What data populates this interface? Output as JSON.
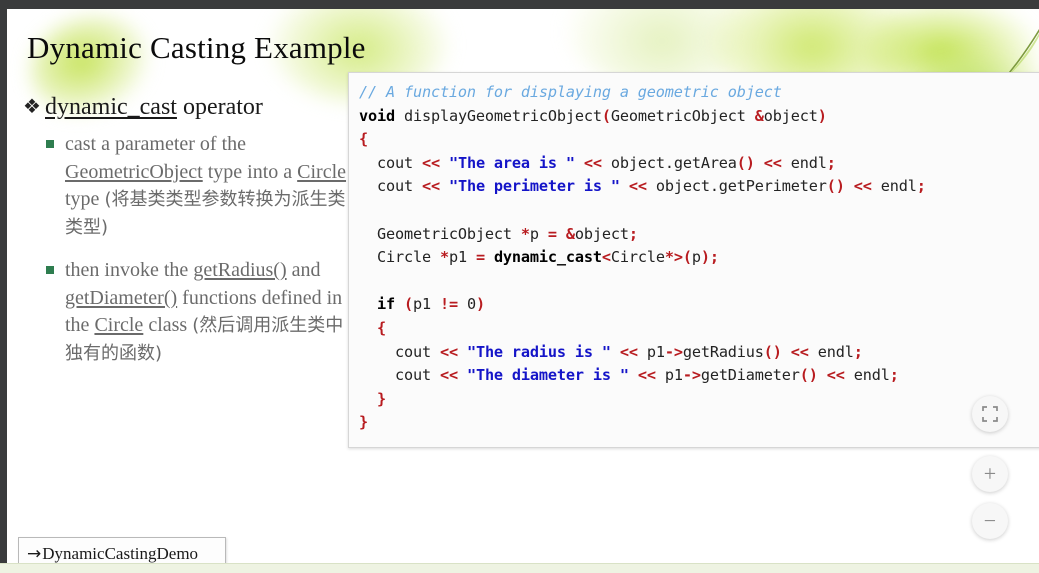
{
  "slide": {
    "title": "Dynamic Casting Example",
    "bullets": {
      "level1_marker": "❖",
      "level1": {
        "underlined": "dynamic_cast",
        "rest": " operator"
      },
      "level2": [
        {
          "marker": "square-bullet",
          "parts": [
            {
              "text": "cast a parameter of the ",
              "underline": false
            },
            {
              "text": "GeometricObject",
              "underline": true
            },
            {
              "text": " type into a ",
              "underline": false
            },
            {
              "text": "Circle",
              "underline": true
            },
            {
              "text": " type ",
              "underline": false
            },
            {
              "text": "(将基类类型参数转换为派生类类型)",
              "underline": false,
              "cjk": true
            }
          ]
        },
        {
          "marker": "square-bullet",
          "parts": [
            {
              "text": "then invoke the ",
              "underline": false
            },
            {
              "text": "getRadius()",
              "underline": true
            },
            {
              "text": " and ",
              "underline": false
            },
            {
              "text": "getDiameter()",
              "underline": true
            },
            {
              "text": " functions defined in the ",
              "underline": false
            },
            {
              "text": "Circle",
              "underline": true
            },
            {
              "text": " class ",
              "underline": false
            },
            {
              "text": "(然后调用派生类中独有的函数)",
              "underline": false,
              "cjk": true
            }
          ]
        }
      ]
    },
    "demo_button": {
      "arrow": "→",
      "label": "DynamicCastingDemo"
    }
  },
  "code": {
    "language": "cpp",
    "lines": [
      [
        {
          "t": "// A function for displaying a geometric object",
          "c": "com"
        }
      ],
      [
        {
          "t": "void",
          "c": "kw"
        },
        {
          "t": " displayGeometricObject",
          "c": "pl"
        },
        {
          "t": "(",
          "c": "pun"
        },
        {
          "t": "GeometricObject ",
          "c": "pl"
        },
        {
          "t": "&",
          "c": "pun"
        },
        {
          "t": "object",
          "c": "pl"
        },
        {
          "t": ")",
          "c": "pun"
        }
      ],
      [
        {
          "t": "{",
          "c": "pun"
        }
      ],
      [
        {
          "t": "  cout ",
          "c": "pl"
        },
        {
          "t": "<<",
          "c": "op"
        },
        {
          "t": " ",
          "c": "pl"
        },
        {
          "t": "\"The area is \"",
          "c": "str"
        },
        {
          "t": " ",
          "c": "pl"
        },
        {
          "t": "<<",
          "c": "op"
        },
        {
          "t": " object.getArea",
          "c": "pl"
        },
        {
          "t": "()",
          "c": "pun"
        },
        {
          "t": " ",
          "c": "pl"
        },
        {
          "t": "<<",
          "c": "op"
        },
        {
          "t": " endl",
          "c": "pl"
        },
        {
          "t": ";",
          "c": "pun"
        }
      ],
      [
        {
          "t": "  cout ",
          "c": "pl"
        },
        {
          "t": "<<",
          "c": "op"
        },
        {
          "t": " ",
          "c": "pl"
        },
        {
          "t": "\"The perimeter is \"",
          "c": "str"
        },
        {
          "t": " ",
          "c": "pl"
        },
        {
          "t": "<<",
          "c": "op"
        },
        {
          "t": " object.getPerimeter",
          "c": "pl"
        },
        {
          "t": "()",
          "c": "pun"
        },
        {
          "t": " ",
          "c": "pl"
        },
        {
          "t": "<<",
          "c": "op"
        },
        {
          "t": " endl",
          "c": "pl"
        },
        {
          "t": ";",
          "c": "pun"
        }
      ],
      [
        {
          "t": "",
          "c": "pl"
        }
      ],
      [
        {
          "t": "  GeometricObject ",
          "c": "pl"
        },
        {
          "t": "*",
          "c": "op"
        },
        {
          "t": "p ",
          "c": "pl"
        },
        {
          "t": "=",
          "c": "op"
        },
        {
          "t": " ",
          "c": "pl"
        },
        {
          "t": "&",
          "c": "op"
        },
        {
          "t": "object",
          "c": "pl"
        },
        {
          "t": ";",
          "c": "pun"
        }
      ],
      [
        {
          "t": "  Circle ",
          "c": "pl"
        },
        {
          "t": "*",
          "c": "op"
        },
        {
          "t": "p1 ",
          "c": "pl"
        },
        {
          "t": "=",
          "c": "op"
        },
        {
          "t": " ",
          "c": "pl"
        },
        {
          "t": "dynamic_cast",
          "c": "kw"
        },
        {
          "t": "<",
          "c": "op"
        },
        {
          "t": "Circle",
          "c": "pl"
        },
        {
          "t": "*",
          "c": "op"
        },
        {
          "t": ">(",
          "c": "op"
        },
        {
          "t": "p",
          "c": "pl"
        },
        {
          "t": ")",
          "c": "pun"
        },
        {
          "t": ";",
          "c": "pun"
        }
      ],
      [
        {
          "t": "",
          "c": "pl"
        }
      ],
      [
        {
          "t": "  ",
          "c": "pl"
        },
        {
          "t": "if",
          "c": "kw"
        },
        {
          "t": " ",
          "c": "pl"
        },
        {
          "t": "(",
          "c": "pun"
        },
        {
          "t": "p1 ",
          "c": "pl"
        },
        {
          "t": "!=",
          "c": "op"
        },
        {
          "t": " ",
          "c": "pl"
        },
        {
          "t": "0",
          "c": "pl"
        },
        {
          "t": ")",
          "c": "pun"
        }
      ],
      [
        {
          "t": "  ",
          "c": "pl"
        },
        {
          "t": "{",
          "c": "pun"
        }
      ],
      [
        {
          "t": "    cout ",
          "c": "pl"
        },
        {
          "t": "<<",
          "c": "op"
        },
        {
          "t": " ",
          "c": "pl"
        },
        {
          "t": "\"The radius is \"",
          "c": "str"
        },
        {
          "t": " ",
          "c": "pl"
        },
        {
          "t": "<<",
          "c": "op"
        },
        {
          "t": " p1",
          "c": "pl"
        },
        {
          "t": "->",
          "c": "op"
        },
        {
          "t": "getRadius",
          "c": "pl"
        },
        {
          "t": "()",
          "c": "pun"
        },
        {
          "t": " ",
          "c": "pl"
        },
        {
          "t": "<<",
          "c": "op"
        },
        {
          "t": " endl",
          "c": "pl"
        },
        {
          "t": ";",
          "c": "pun"
        }
      ],
      [
        {
          "t": "    cout ",
          "c": "pl"
        },
        {
          "t": "<<",
          "c": "op"
        },
        {
          "t": " ",
          "c": "pl"
        },
        {
          "t": "\"The diameter is \"",
          "c": "str"
        },
        {
          "t": " ",
          "c": "pl"
        },
        {
          "t": "<<",
          "c": "op"
        },
        {
          "t": " p1",
          "c": "pl"
        },
        {
          "t": "->",
          "c": "op"
        },
        {
          "t": "getDiameter",
          "c": "pl"
        },
        {
          "t": "()",
          "c": "pun"
        },
        {
          "t": " ",
          "c": "pl"
        },
        {
          "t": "<<",
          "c": "op"
        },
        {
          "t": " endl",
          "c": "pl"
        },
        {
          "t": ";",
          "c": "pun"
        }
      ],
      [
        {
          "t": "  ",
          "c": "pl"
        },
        {
          "t": "}",
          "c": "pun"
        }
      ],
      [
        {
          "t": "}",
          "c": "pun"
        }
      ]
    ]
  },
  "controls": {
    "expand": {
      "icon": "fullscreen-icon",
      "label": ""
    },
    "zoom_in": {
      "icon": "plus-icon",
      "label": "+"
    },
    "zoom_out": {
      "icon": "minus-icon",
      "label": "−"
    }
  },
  "colors": {
    "comment": "#6aa9e0",
    "string": "#1414c8",
    "operator": "#b81c20",
    "keyword": "#000000",
    "plain": "#232323",
    "bullet_green": "#2e7d4f",
    "chrome_dark": "#3a3b3c"
  }
}
